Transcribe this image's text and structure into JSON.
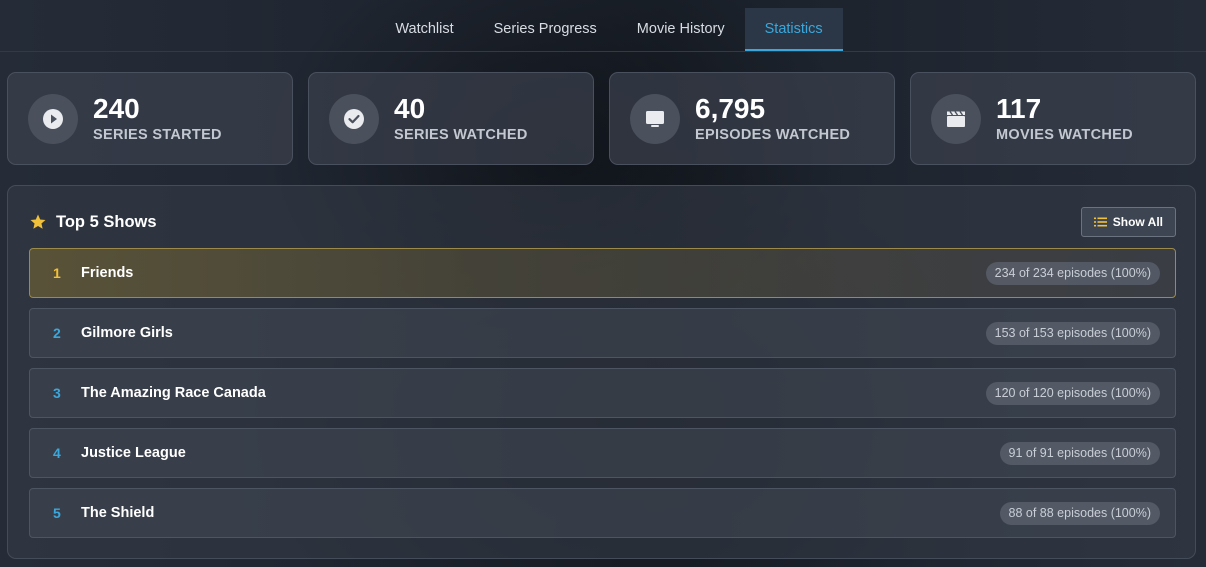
{
  "nav": {
    "tabs": [
      {
        "label": "Watchlist"
      },
      {
        "label": "Series Progress"
      },
      {
        "label": "Movie History"
      },
      {
        "label": "Statistics"
      }
    ]
  },
  "stats": [
    {
      "value": "240",
      "label": "SERIES STARTED",
      "icon": "play-circle-icon"
    },
    {
      "value": "40",
      "label": "SERIES WATCHED",
      "icon": "check-circle-icon"
    },
    {
      "value": "6,795",
      "label": "EPISODES WATCHED",
      "icon": "tv-icon"
    },
    {
      "value": "117",
      "label": "MOVIES WATCHED",
      "icon": "film-icon"
    }
  ],
  "top_shows": {
    "title": "Top 5 Shows",
    "show_all_label": "Show All",
    "items": [
      {
        "rank": "1",
        "name": "Friends",
        "episodes": "234 of 234 episodes (100%)"
      },
      {
        "rank": "2",
        "name": "Gilmore Girls",
        "episodes": "153 of 153 episodes (100%)"
      },
      {
        "rank": "3",
        "name": "The Amazing Race Canada",
        "episodes": "120 of 120 episodes (100%)"
      },
      {
        "rank": "4",
        "name": "Justice League",
        "episodes": "91 of 91 episodes (100%)"
      },
      {
        "rank": "5",
        "name": "The Shield",
        "episodes": "88 of 88 episodes (100%)"
      }
    ]
  },
  "colors": {
    "accent": "#3aa8dc",
    "gold": "#f2c13a"
  }
}
